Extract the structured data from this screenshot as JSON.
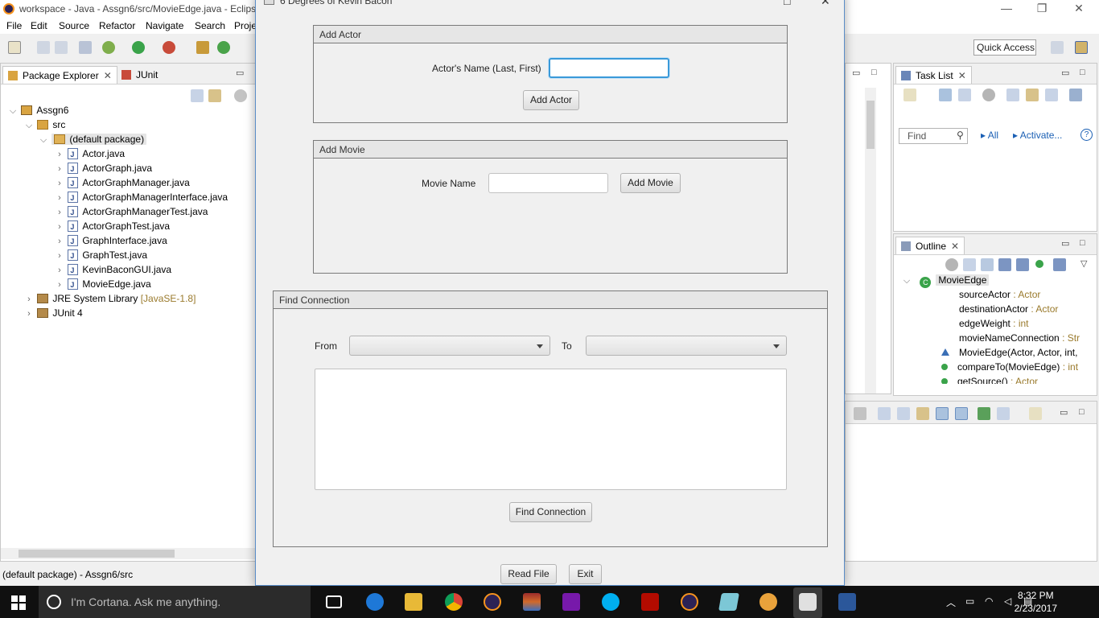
{
  "eclipse": {
    "window_title": "workspace - Java - Assgn6/src/MovieEdge.java - Eclipse",
    "menu": [
      "File",
      "Edit",
      "Source",
      "Refactor",
      "Navigate",
      "Search",
      "Proje"
    ],
    "quick_access": "Quick Access",
    "package_explorer": {
      "tab_label": "Package Explorer",
      "junit_tab_label": "JUnit",
      "project": "Assgn6",
      "src": "src",
      "package": "(default package)",
      "files": [
        "Actor.java",
        "ActorGraph.java",
        "ActorGraphManager.java",
        "ActorGraphManagerInterface.java",
        "ActorGraphManagerTest.java",
        "ActorGraphTest.java",
        "GraphInterface.java",
        "GraphTest.java",
        "KevinBaconGUI.java",
        "MovieEdge.java"
      ],
      "jre": "JRE System Library",
      "jre_version": "[JavaSE-1.8]",
      "junit4": "JUnit 4"
    },
    "task_list": {
      "tab_label": "Task List",
      "find_placeholder": "Find",
      "all_link": "All",
      "activate_link": "Activate..."
    },
    "outline": {
      "tab_label": "Outline",
      "class_name": "MovieEdge",
      "members": [
        {
          "name": "sourceActor",
          "type": " : Actor"
        },
        {
          "name": "destinationActor",
          "type": " : Actor"
        },
        {
          "name": "edgeWeight",
          "type": " : int"
        },
        {
          "name": "movieNameConnection",
          "type": " : Str"
        },
        {
          "name": "MovieEdge(Actor, Actor, int,",
          "type": ""
        },
        {
          "name": "compareTo(MovieEdge)",
          "type": " : int"
        },
        {
          "name": "getSource()",
          "type": " : Actor"
        }
      ]
    },
    "status_text": "(default package) - Assgn6/src"
  },
  "dialog": {
    "title": "6 Degrees of Kevin Bacon",
    "add_actor": {
      "header": "Add Actor",
      "label": "Actor's Name (Last, First)",
      "input_value": "",
      "button": "Add Actor"
    },
    "add_movie": {
      "header": "Add Movie",
      "label": "Movie Name",
      "input_value": "",
      "button": "Add Movie"
    },
    "find_connection": {
      "header": "Find Connection",
      "from_label": "From",
      "to_label": "To",
      "from_value": "",
      "to_value": "",
      "button": "Find Connection"
    },
    "read_file_button": "Read File",
    "exit_button": "Exit"
  },
  "taskbar": {
    "cortana_text": "I'm Cortana. Ask me anything.",
    "time": "8:32 PM",
    "date": "2/23/2017"
  }
}
